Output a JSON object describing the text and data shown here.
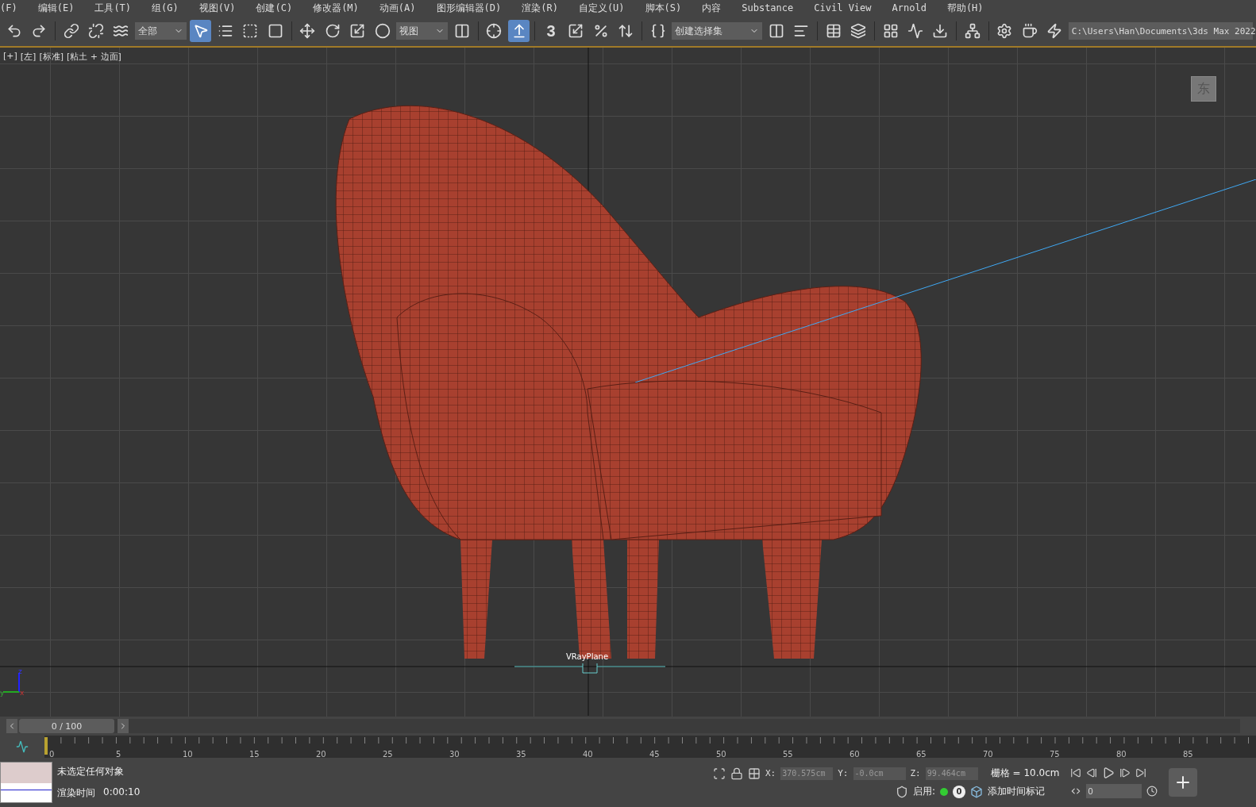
{
  "menu": [
    "(F)",
    "编辑(E)",
    "工具(T)",
    "组(G)",
    "视图(V)",
    "创建(C)",
    "修改器(M)",
    "动画(A)",
    "图形编辑器(D)",
    "渲染(R)",
    "自定义(U)",
    "脚本(S)",
    "内容",
    "Substance",
    "Civil View",
    "Arnold",
    "帮助(H)"
  ],
  "toolbar": {
    "selection_filter": "全部",
    "select_active": true,
    "reference_coord": "视图",
    "snap_active": true,
    "snap_label": "3",
    "named_selection": "创建选择集",
    "project_path": "C:\\Users\\Han\\Documents\\3ds Max 2022"
  },
  "viewport": {
    "labels": [
      "[+]",
      "[左]",
      "[标准]",
      "[粘土 + 边面]"
    ],
    "viewcube": "东",
    "object_label": "VRayPlane",
    "axes": [
      "z",
      "y",
      "x"
    ]
  },
  "time_slider": {
    "text": "0 / 100",
    "level": 0
  },
  "ruler": {
    "ticks": [
      "0",
      "5",
      "10",
      "15",
      "20",
      "25",
      "30",
      "35",
      "40",
      "45",
      "50",
      "55",
      "60",
      "65",
      "70",
      "75",
      "80",
      "85"
    ]
  },
  "status": {
    "selection": "未选定任何对象",
    "render_label": "渲染时间",
    "render_time": "0:00:10",
    "x_label": "X:",
    "x": "370.575cm",
    "y_label": "Y:",
    "y": "-0.0cm",
    "z_label": "Z:",
    "z": "99.464cm",
    "grid": "栅格 = 10.0cm",
    "enable_label": "启用:",
    "key_count": "0",
    "add_time_tag": "添加时间标记",
    "frame": "0"
  }
}
